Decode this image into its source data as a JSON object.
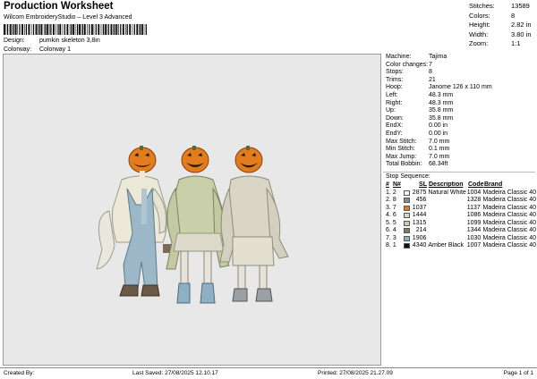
{
  "header": {
    "title": "Production Worksheet",
    "subtitle": "Wilcom EmbroideryStudio – Level 3 Advanced",
    "design_label": "Design:",
    "design_value": "pumkin skeleton 3,8in",
    "colorway_label": "Colorway:",
    "colorway_value": "Colorway 1"
  },
  "stats": [
    {
      "label": "Stitches:",
      "value": "13589"
    },
    {
      "label": "Colors:",
      "value": "8"
    },
    {
      "label": "Height:",
      "value": "2.82 in"
    },
    {
      "label": "Width:",
      "value": "3.80 in"
    },
    {
      "label": "Zoom:",
      "value": "1:1"
    }
  ],
  "machine_info": [
    {
      "label": "Machine:",
      "value": "Tajima"
    },
    {
      "label": "Color changes:",
      "value": "7"
    },
    {
      "label": "Stops:",
      "value": "8"
    },
    {
      "label": "Trims:",
      "value": "21"
    },
    {
      "label": "Hoop:",
      "value": "Janome 126 x 110 mm"
    },
    {
      "label": "Left:",
      "value": "48.3 mm"
    },
    {
      "label": "Right:",
      "value": "48.3 mm"
    },
    {
      "label": "Up:",
      "value": "35.8 mm"
    },
    {
      "label": "Down:",
      "value": "35.8 mm"
    },
    {
      "label": "EndX:",
      "value": "0.00 in"
    },
    {
      "label": "EndY:",
      "value": "0.00 in"
    },
    {
      "label": "Max Stitch:",
      "value": "7.0 mm"
    },
    {
      "label": "Min Stitch:",
      "value": "0.1 mm"
    },
    {
      "label": "Max Jump:",
      "value": "7.0 mm"
    },
    {
      "label": "Total Bobbin:",
      "value": "68.34ft"
    }
  ],
  "stop_sequence": {
    "label": "Stop Sequence:",
    "columns": [
      "#",
      "N#",
      "SL",
      "Description",
      "Code",
      "Brand"
    ],
    "rows": [
      {
        "num": "1.",
        "idx": "2",
        "color": "#f5f5f5",
        "code": "2875",
        "desc": "Natural White",
        "mcode": "1004",
        "brand": "Madeira Classic 40"
      },
      {
        "num": "2.",
        "idx": "8",
        "color": "#8a8a8a",
        "code": "456",
        "desc": "",
        "mcode": "1328",
        "brand": "Madeira Classic 40"
      },
      {
        "num": "3.",
        "idx": "7",
        "color": "#e07a1a",
        "code": "1037",
        "desc": "",
        "mcode": "1137",
        "brand": "Madeira Classic 40"
      },
      {
        "num": "4.",
        "idx": "6",
        "color": "#d9d6c5",
        "code": "1444",
        "desc": "",
        "mcode": "1086",
        "brand": "Madeira Classic 40"
      },
      {
        "num": "5.",
        "idx": "5",
        "color": "#c9cfa8",
        "code": "1315",
        "desc": "",
        "mcode": "1099",
        "brand": "Madeira Classic 40"
      },
      {
        "num": "6.",
        "idx": "4",
        "color": "#7a7a72",
        "code": "214",
        "desc": "",
        "mcode": "1344",
        "brand": "Madeira Classic 40"
      },
      {
        "num": "7.",
        "idx": "3",
        "color": "#8fb0c4",
        "code": "1906",
        "desc": "",
        "mcode": "1030",
        "brand": "Madeira Classic 40"
      },
      {
        "num": "8.",
        "idx": "1",
        "color": "#111111",
        "code": "4340",
        "desc": "Amber Black",
        "mcode": "1007",
        "brand": "Madeira Classic 40"
      }
    ]
  },
  "footer": {
    "created_by": "Created By:",
    "last_saved": "Last Saved: 27/08/2025 12.10.17",
    "printed": "Printed: 27/08/2025 21.27.09",
    "page": "Page 1 of 1"
  }
}
